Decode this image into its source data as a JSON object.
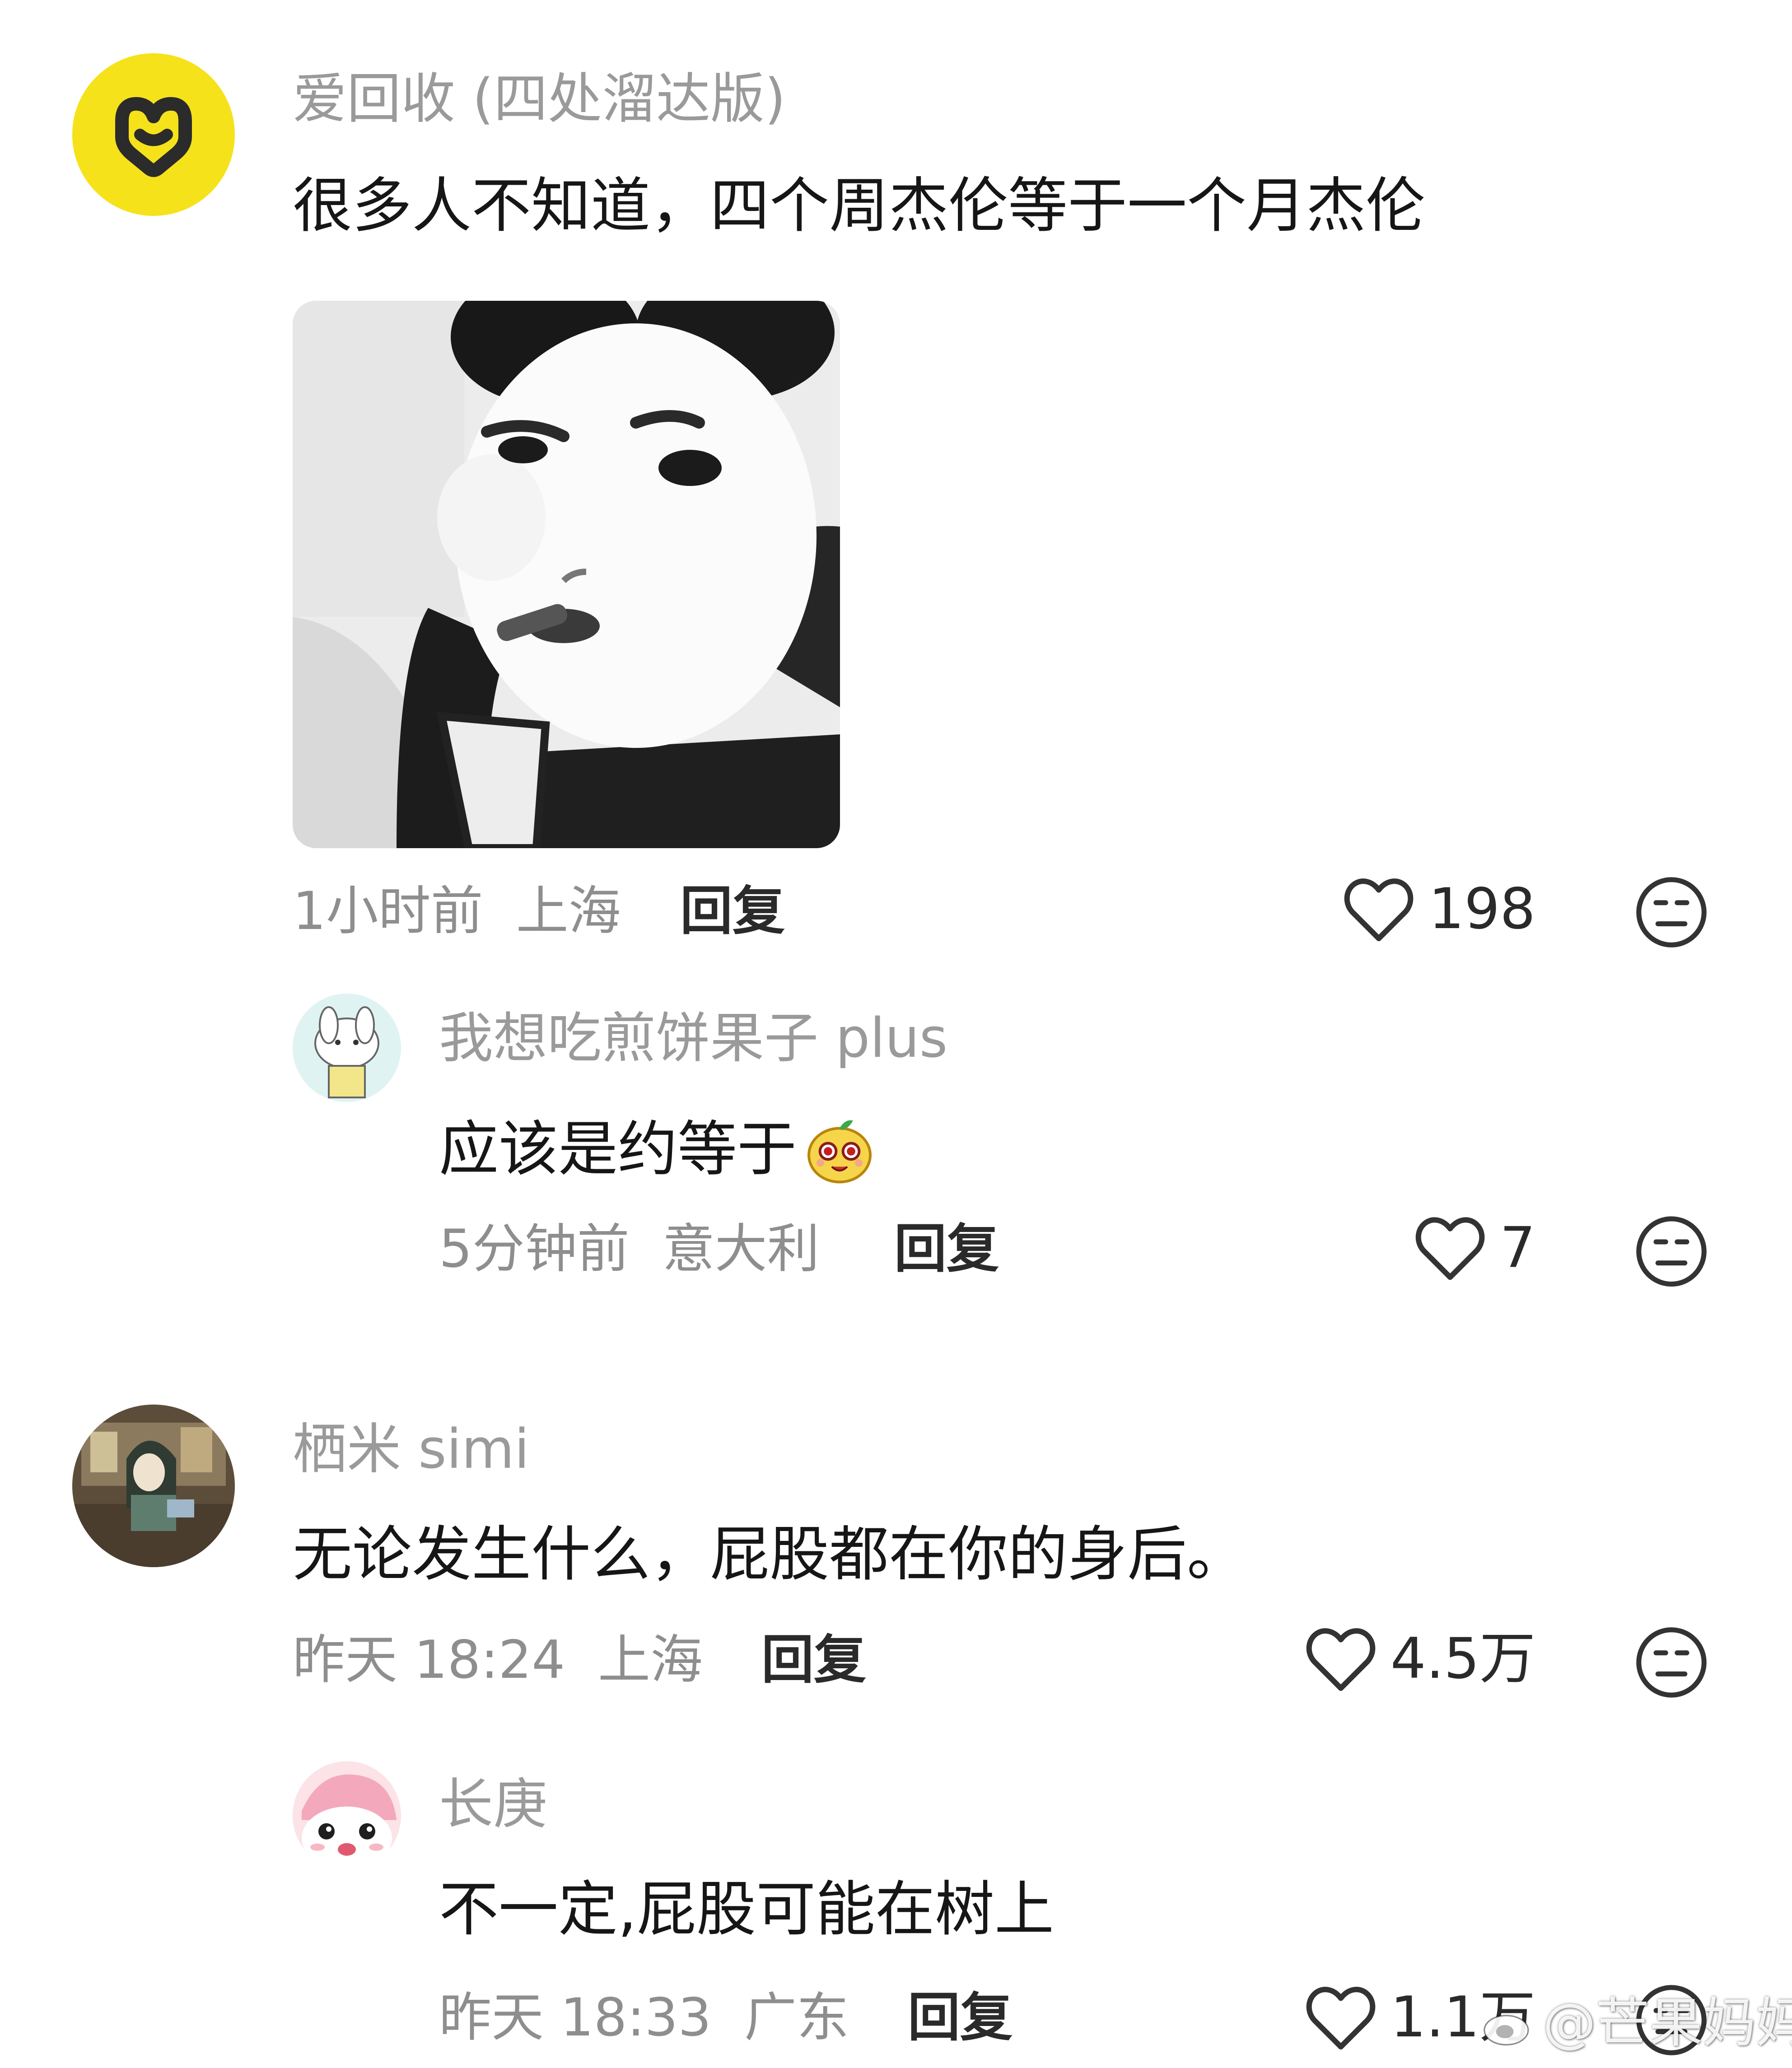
{
  "comments": [
    {
      "username": "爱回收 (四处溜达版)",
      "text": "很多人不知道，四个周杰伦等于一个月杰伦",
      "time": "1小时前",
      "location": "上海",
      "reply_label": "回复",
      "likes": "198",
      "avatar_icon": "yellow-logo-avatar",
      "replies": [
        {
          "username": "我想吃煎饼果子 plus",
          "text": "应该是约等于",
          "emoji_icon": "fruit-face-emoji",
          "time": "5分钟前",
          "location": "意大利",
          "reply_label": "回复",
          "likes": "7"
        }
      ]
    },
    {
      "username": "栖米 simi",
      "text": "无论发生什么，屁股都在你的身后。",
      "time": "昨天 18:24",
      "location": "上海",
      "reply_label": "回复",
      "likes": "4.5万",
      "replies": [
        {
          "username": "长庚",
          "text": "不一定,屁股可能在树上",
          "time": "昨天 18:33",
          "location": "广东",
          "reply_label": "回复",
          "likes": "1.1万"
        }
      ]
    }
  ],
  "watermark": "@芒果妈妈",
  "colors": {
    "avatar_yellow": "#f5e21a",
    "avatar_logo": "#2b2b2b",
    "username_gray": "#9a9a9a",
    "meta_gray": "#8e8e8e"
  }
}
